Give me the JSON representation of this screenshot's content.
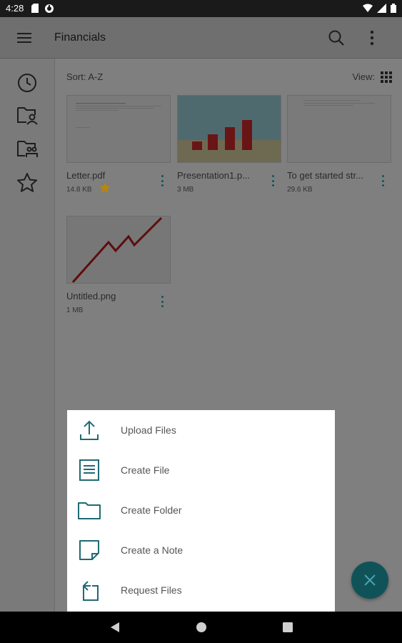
{
  "status_bar": {
    "time": "4:28",
    "left_icons": [
      "sd-card-icon",
      "sync-icon"
    ],
    "right_icons": [
      "wifi-icon",
      "signal-icon",
      "battery-icon"
    ]
  },
  "app_bar": {
    "title": "Financials",
    "menu_icon": "hamburger-menu-icon",
    "search_icon": "search-icon",
    "more_icon": "more-vert-icon"
  },
  "side_rail": {
    "items": [
      {
        "icon": "recent-clock-icon"
      },
      {
        "icon": "shared-with-me-folder-icon"
      },
      {
        "icon": "shared-folder-icon"
      },
      {
        "icon": "favorites-star-icon"
      }
    ]
  },
  "toolbar": {
    "sort_label": "Sort: A-Z",
    "view_label": "View:",
    "view_icon": "grid-view-icon"
  },
  "files": [
    {
      "name": "Letter.pdf",
      "size": "14.8 KB",
      "favorite": true,
      "thumb": "document-thumbnail"
    },
    {
      "name": "Presentation1.p...",
      "size": "3 MB",
      "favorite": false,
      "thumb": "bar-chart-thumbnail"
    },
    {
      "name": "To get started str...",
      "size": "29.6 KB",
      "favorite": false,
      "thumb": "text-document-thumbnail"
    },
    {
      "name": "Untitled.png",
      "size": "1 MB",
      "favorite": false,
      "thumb": "line-chart-thumbnail"
    }
  ],
  "sheet": {
    "items": [
      {
        "label": "Upload Files",
        "icon": "upload-icon"
      },
      {
        "label": "Create File",
        "icon": "create-file-icon"
      },
      {
        "label": "Create Folder",
        "icon": "folder-icon"
      },
      {
        "label": "Create a Note",
        "icon": "note-icon"
      },
      {
        "label": "Request Files",
        "icon": "request-files-icon"
      }
    ]
  },
  "fab": {
    "icon": "close-icon"
  },
  "colors": {
    "accent": "#11535a",
    "fab": "#0f5359",
    "star": "#b8860b",
    "scrim_bg": "#7f7f7f"
  },
  "nav_bar": {
    "buttons": [
      "back-icon",
      "home-icon",
      "recents-icon"
    ]
  }
}
